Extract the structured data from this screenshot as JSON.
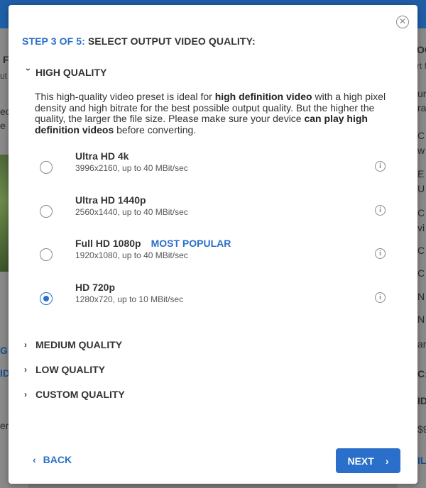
{
  "background": {
    "left_fragments": [
      "F",
      "ut",
      "eo",
      "e",
      "G",
      "ID",
      "er"
    ],
    "right_fragments": [
      "OC",
      "rt f",
      "ur",
      "ra",
      "C",
      "w",
      "E",
      "U",
      "C",
      "vi",
      "C",
      "C",
      "N",
      "N",
      "ar",
      "C:",
      "ID",
      "$9",
      "IL"
    ]
  },
  "modal": {
    "close_icon": "close-icon",
    "step": {
      "number_label": "STEP 3 OF 5:",
      "title": "SELECT OUTPUT VIDEO QUALITY:"
    },
    "sections": {
      "high": {
        "label": "HIGH QUALITY",
        "expanded": true
      },
      "medium": {
        "label": "MEDIUM QUALITY"
      },
      "low": {
        "label": "LOW QUALITY"
      },
      "custom": {
        "label": "CUSTOM QUALITY"
      }
    },
    "description": {
      "part1": "This high-quality video preset is ideal for ",
      "bold1": "high definition video",
      "part2": " with a high pixel density and high bitrate for the best possible output quality. But the higher the quality, the larger the file size. Please make sure your device ",
      "bold2": "can play high definition videos",
      "part3": " before converting."
    },
    "options": [
      {
        "name": "Ultra HD 4k",
        "detail": "3996x2160, up to 40 MBit/sec",
        "badge": "",
        "selected": false
      },
      {
        "name": "Ultra HD 1440p",
        "detail": "2560x1440, up to 40 MBit/sec",
        "badge": "",
        "selected": false
      },
      {
        "name": "Full HD 1080p",
        "detail": "1920x1080, up to 40 MBit/sec",
        "badge": "MOST POPULAR",
        "selected": false
      },
      {
        "name": "HD 720p",
        "detail": "1280x720, up to 10 MBit/sec",
        "badge": "",
        "selected": true
      }
    ],
    "buttons": {
      "back": "BACK",
      "next": "NEXT"
    },
    "colors": {
      "accent": "#2a6fc9",
      "text": "#333333"
    }
  }
}
